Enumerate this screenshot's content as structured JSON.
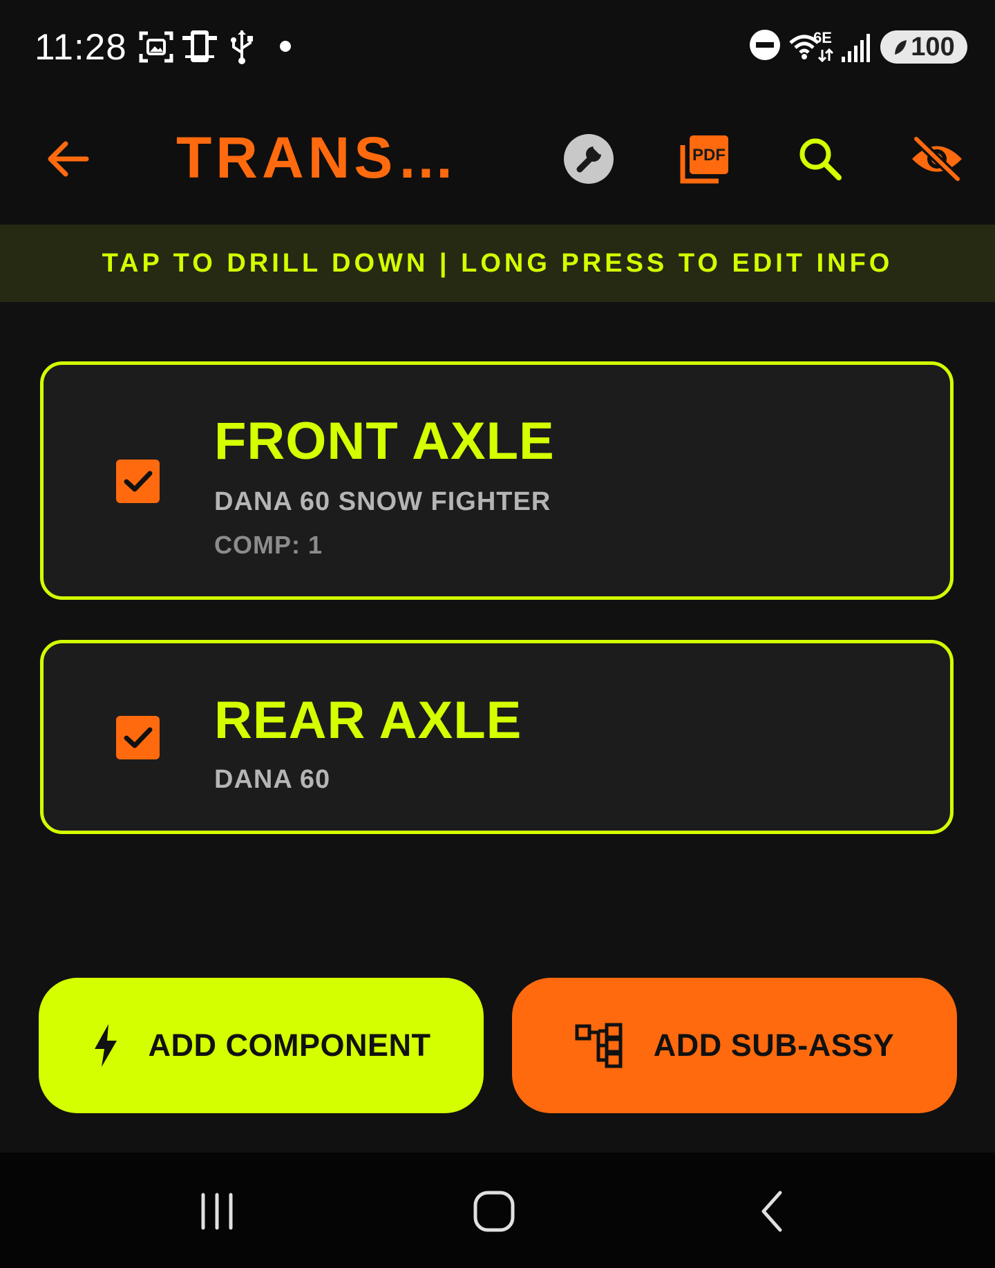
{
  "status_bar": {
    "time": "11:28",
    "network": "6E",
    "battery": "100",
    "icons": [
      "screenshot-icon",
      "device-icon",
      "usb-icon",
      "notification-dot-icon",
      "do-not-disturb-icon",
      "wifi-icon",
      "signal-icon",
      "battery-icon"
    ]
  },
  "app_bar": {
    "title": "TRANSMISSION",
    "pdf_label": "PDF",
    "icons": [
      "back-arrow-icon",
      "wrench-icon",
      "pdf-icon",
      "search-icon",
      "hide-eye-icon"
    ]
  },
  "hint": {
    "text": "TAP TO DRILL DOWN | LONG PRESS TO EDIT INFO"
  },
  "items": [
    {
      "title": "FRONT AXLE",
      "subtitle": "DANA 60 SNOW FIGHTER",
      "meta": "COMP: 1",
      "checked": true
    },
    {
      "title": "REAR AXLE",
      "subtitle": "DANA 60",
      "checked": true
    }
  ],
  "actions": {
    "add_component": "ADD COMPONENT",
    "add_subassy": "ADD SUB-ASSY"
  },
  "colors": {
    "accent_lime": "#d4ff00",
    "accent_orange": "#ff6a0e",
    "background": "#111111",
    "card": "#1c1c1c"
  },
  "nav_bar": {
    "icons": [
      "recent-apps-icon",
      "home-icon",
      "back-icon"
    ]
  }
}
